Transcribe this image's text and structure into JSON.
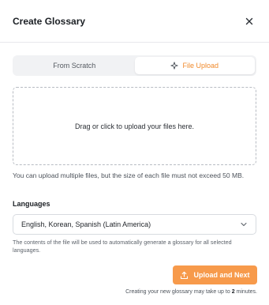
{
  "dialog": {
    "title": "Create Glossary",
    "close_icon": "close-icon"
  },
  "tabs": [
    {
      "label": "From Scratch",
      "active": false
    },
    {
      "label": "File Upload",
      "active": true,
      "icon": "sparkle-icon"
    }
  ],
  "upload": {
    "dropzone_text": "Drag or click to upload your files here.",
    "note": "You can upload multiple files, but the size of each file must not exceed 50 MB."
  },
  "languages": {
    "label": "Languages",
    "selected": "English, Korean, Spanish (Latin America)",
    "help": "The contents of the file will be used to automatically generate a glossary for all selected languages."
  },
  "actions": {
    "primary_label": "Upload and Next",
    "primary_icon": "upload-icon",
    "footer_prefix": "Creating your new glossary may take up to ",
    "footer_value": "2",
    "footer_suffix": " minutes."
  },
  "colors": {
    "accent": "#f08a2c",
    "button": "#f79a4b"
  }
}
